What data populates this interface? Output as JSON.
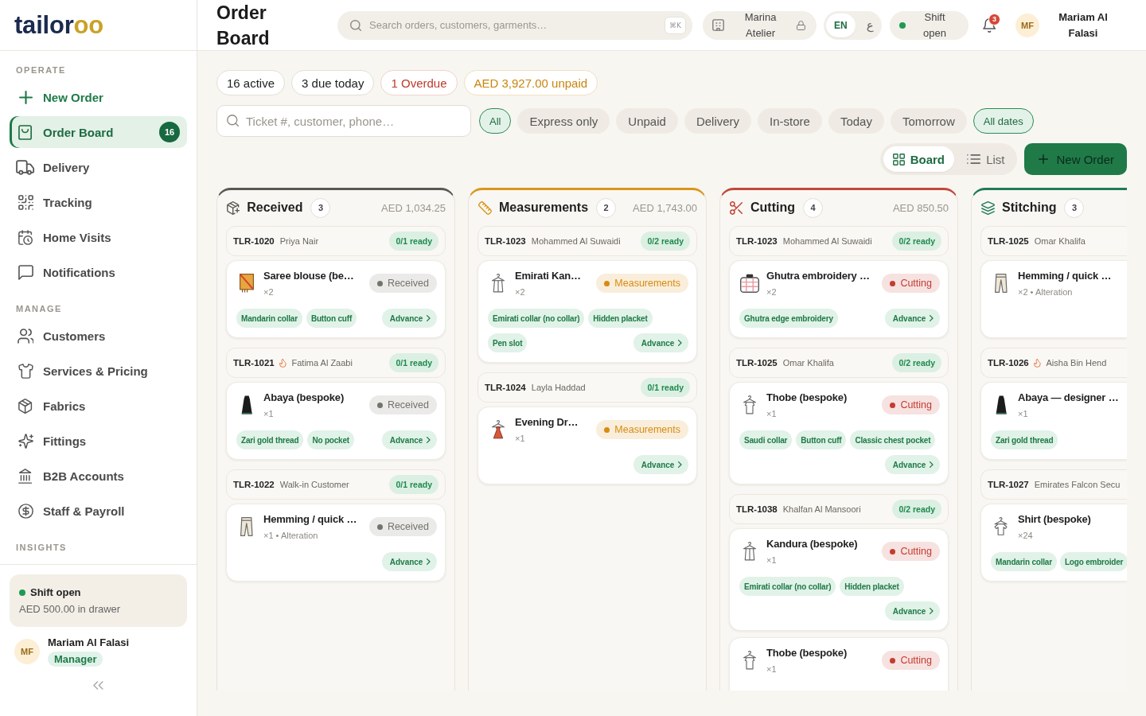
{
  "sidebar": {
    "logo": {
      "text": "tailor",
      "accent": "oo"
    },
    "sections": [
      {
        "title": "OPERATE",
        "items": [
          {
            "label": "New Order",
            "kind": "action",
            "selected": false
          },
          {
            "label": "Order Board",
            "kind": "link",
            "selected": true,
            "badge": "16"
          },
          {
            "label": "Delivery",
            "kind": "link",
            "selected": false
          },
          {
            "label": "Tracking",
            "kind": "link",
            "selected": false
          },
          {
            "label": "Home Visits",
            "kind": "link",
            "selected": false
          },
          {
            "label": "Notifications",
            "kind": "link",
            "selected": false
          }
        ]
      },
      {
        "title": "MANAGE",
        "items": [
          {
            "label": "Customers",
            "kind": "link",
            "selected": false
          },
          {
            "label": "Services & Pricing",
            "kind": "link",
            "selected": false
          },
          {
            "label": "Fabrics",
            "kind": "link",
            "selected": false
          },
          {
            "label": "Fittings",
            "kind": "link",
            "selected": false
          },
          {
            "label": "B2B Accounts",
            "kind": "link",
            "selected": false
          },
          {
            "label": "Staff & Payroll",
            "kind": "link",
            "selected": false
          }
        ]
      },
      {
        "title": "INSIGHTS"
      }
    ],
    "shift": {
      "label": "Shift open",
      "open": true,
      "detail": "AED 500.00 in drawer"
    },
    "user": {
      "initials": "MF",
      "name": "Mariam Al Falasi",
      "role": "Manager"
    }
  },
  "header": {
    "title": "Order Board",
    "search": {
      "placeholder": "Search orders, customers, garments…",
      "shortcut": "⌘K"
    },
    "branch": "Marina Atelier",
    "languages": [
      {
        "label": "EN",
        "selected": true
      },
      {
        "label": "ع",
        "selected": false
      }
    ],
    "shift": {
      "label": "Shift open",
      "open": true
    },
    "notifications": "3",
    "user": {
      "initials": "MF",
      "name": "Mariam Al Falasi"
    }
  },
  "summary": [
    {
      "text": "16 active",
      "kind": "neutral"
    },
    {
      "text": "3 due today",
      "kind": "neutral"
    },
    {
      "text": "1 Overdue",
      "kind": "danger"
    },
    {
      "text": "AED 3,927.00 unpaid",
      "kind": "warning"
    }
  ],
  "filters": {
    "search": {
      "placeholder": "Ticket #, customer, phone…"
    },
    "chips": [
      {
        "label": "All",
        "selected": true
      },
      {
        "label": "Express only",
        "selected": false
      },
      {
        "label": "Unpaid",
        "selected": false
      },
      {
        "label": "Delivery",
        "selected": false
      },
      {
        "label": "In-store",
        "selected": false
      },
      {
        "label": "Today",
        "selected": false
      },
      {
        "label": "Tomorrow",
        "selected": false
      },
      {
        "label": "All dates",
        "selected": true
      }
    ]
  },
  "view": {
    "modes": [
      {
        "label": "Board",
        "selected": true
      },
      {
        "label": "List",
        "selected": false
      }
    ],
    "new_order": "New Order"
  },
  "columns": [
    {
      "title": "Received",
      "color": "#5b5853",
      "count": "3",
      "total": "AED 1,034.25",
      "orders": [
        {
          "ticket": "TLR-1020",
          "express": false,
          "customer": "Priya Nair",
          "ready": "0/1 ready",
          "items": [
            {
              "name": "Saree blouse (be…",
              "kind": "saree",
              "meta": "×2",
              "status": {
                "label": "Received",
                "color": "#76726c"
              },
              "tags": [
                "Mandarin collar",
                "Button cuff"
              ],
              "action": "Advance"
            }
          ]
        },
        {
          "ticket": "TLR-1021",
          "express": true,
          "customer": "Fatima Al Zaabi",
          "ready": "0/1 ready",
          "items": [
            {
              "name": "Abaya (bespoke)",
              "kind": "abaya",
              "meta": "×1",
              "status": {
                "label": "Received",
                "color": "#76726c"
              },
              "tags": [
                "Zari gold thread",
                "No pocket"
              ],
              "action": "Advance"
            }
          ]
        },
        {
          "ticket": "TLR-1022",
          "express": false,
          "customer": "Walk-in Customer",
          "ready": "0/1 ready",
          "items": [
            {
              "name": "Hemming / quick …",
              "kind": "trousers",
              "meta": "×1 • Alteration",
              "status": {
                "label": "Received",
                "color": "#76726c"
              },
              "action": "Advance"
            }
          ]
        }
      ]
    },
    {
      "title": "Measurements",
      "color": "#d9961c",
      "count": "2",
      "total": "AED 1,743.00",
      "orders": [
        {
          "ticket": "TLR-1023",
          "express": false,
          "customer": "Mohammed Al Suwaidi",
          "ready": "0/2 ready",
          "items": [
            {
              "name": "Emirati Kan…",
              "kind": "kandura",
              "meta": "×2",
              "status": {
                "label": "Measurements",
                "color": "#d98b10"
              },
              "tags": [
                "Emirati collar (no collar)",
                "Hidden placket",
                "Pen slot"
              ],
              "action": "Advance"
            }
          ]
        },
        {
          "ticket": "TLR-1024",
          "express": false,
          "customer": "Layla Haddad",
          "ready": "0/1 ready",
          "items": [
            {
              "name": "Evening Dr…",
              "kind": "dress",
              "meta": "×1",
              "status": {
                "label": "Measurements",
                "color": "#d98b10"
              },
              "action": "Advance"
            }
          ]
        }
      ]
    },
    {
      "title": "Cutting",
      "color": "#c0493a",
      "count": "4",
      "total": "AED 850.50",
      "orders": [
        {
          "ticket": "TLR-1023",
          "express": false,
          "customer": "Mohammed Al Suwaidi",
          "ready": "0/2 ready",
          "items": [
            {
              "name": "Ghutra embroidery …",
              "kind": "ghutra",
              "meta": "×2",
              "status": {
                "label": "Cutting",
                "color": "#c53b30"
              },
              "tags": [
                "Ghutra edge embroidery"
              ],
              "action": "Advance"
            }
          ]
        },
        {
          "ticket": "TLR-1025",
          "express": false,
          "customer": "Omar Khalifa",
          "ready": "0/2 ready",
          "items": [
            {
              "name": "Thobe (bespoke)",
              "kind": "thobe",
              "meta": "×1",
              "status": {
                "label": "Cutting",
                "color": "#c53b30"
              },
              "tags": [
                "Saudi collar",
                "Button cuff",
                "Classic chest pocket"
              ],
              "action": "Advance"
            }
          ]
        },
        {
          "ticket": "TLR-1038",
          "express": false,
          "customer": "Khalfan Al Mansoori",
          "ready": "0/2 ready",
          "items": [
            {
              "name": "Kandura (bespoke)",
              "kind": "kandura",
              "meta": "×1",
              "status": {
                "label": "Cutting",
                "color": "#c53b30"
              },
              "tags": [
                "Emirati collar (no collar)",
                "Hidden placket"
              ],
              "action": "Advance"
            },
            {
              "name": "Thobe (bespoke)",
              "kind": "thobe",
              "meta": "×1",
              "status": {
                "label": "Cutting",
                "color": "#c53b30"
              }
            }
          ]
        }
      ]
    },
    {
      "title": "Stitching",
      "color": "#1f7a5a",
      "count": "3",
      "orders": [
        {
          "ticket": "TLR-1025",
          "express": false,
          "customer": "Omar Khalifa",
          "items": [
            {
              "name": "Hemming / quick …",
              "kind": "trousers",
              "meta": "×2 • Alteration"
            }
          ]
        },
        {
          "ticket": "TLR-1026",
          "express": true,
          "customer": "Aisha Bin Hend",
          "items": [
            {
              "name": "Abaya — designer …",
              "kind": "abaya",
              "meta": "×1",
              "tags": [
                "Zari gold thread"
              ]
            }
          ]
        },
        {
          "ticket": "TLR-1027",
          "express": false,
          "customer": "Emirates Falcon Secu",
          "items": [
            {
              "name": "Shirt (bespoke)",
              "kind": "shirt",
              "meta": "×24",
              "tags": [
                "Mandarin collar",
                "Logo embroider"
              ]
            }
          ]
        }
      ]
    }
  ]
}
